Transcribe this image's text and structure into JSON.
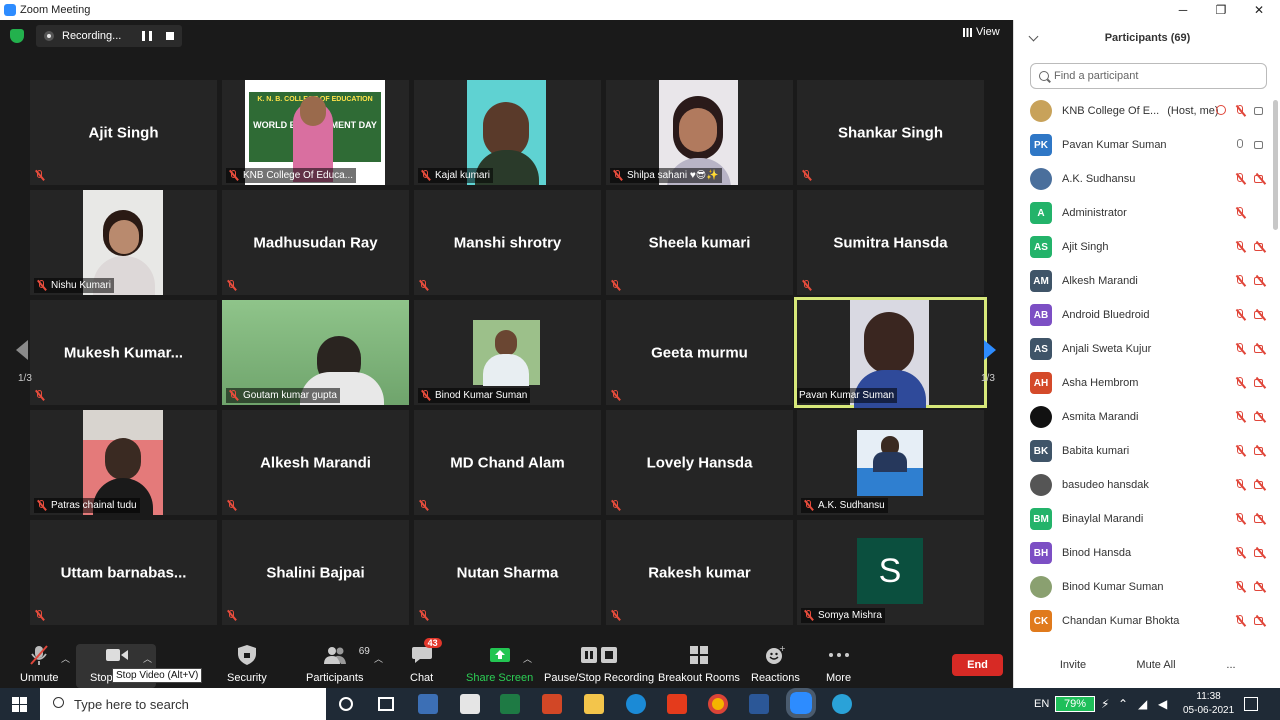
{
  "window": {
    "title": "Zoom Meeting",
    "min": "─",
    "max": "❐",
    "close": "✕"
  },
  "meeting": {
    "recording_label": "Recording...",
    "view_label": "View",
    "page_indicator_left": "1/3",
    "page_indicator_right": "1/3",
    "tiles": [
      {
        "name": "Ajit Singh",
        "label": ""
      },
      {
        "name": "",
        "label": "KNB College Of Educa..."
      },
      {
        "name": "",
        "label": "Kajal kumari"
      },
      {
        "name": "",
        "label": "Shilpa sahani ♥😎✨"
      },
      {
        "name": "Shankar Singh",
        "label": ""
      },
      {
        "name": "",
        "label": "Nishu Kumari"
      },
      {
        "name": "Madhusudan Ray",
        "label": ""
      },
      {
        "name": "Manshi shrotry",
        "label": ""
      },
      {
        "name": "Sheela kumari",
        "label": ""
      },
      {
        "name": "Sumitra Hansda",
        "label": ""
      },
      {
        "name": "Mukesh  Kumar...",
        "label": ""
      },
      {
        "name": "",
        "label": "Goutam kumar gupta"
      },
      {
        "name": "",
        "label": "Binod Kumar Suman"
      },
      {
        "name": "Geeta murmu",
        "label": ""
      },
      {
        "name": "",
        "label": "Pavan Kumar Suman"
      },
      {
        "name": "",
        "label": "Patras chainal tudu"
      },
      {
        "name": "Alkesh Marandi",
        "label": ""
      },
      {
        "name": "MD Chand Alam",
        "label": ""
      },
      {
        "name": "Lovely Hansda",
        "label": ""
      },
      {
        "name": "",
        "label": "A.K. Sudhansu"
      },
      {
        "name": "Uttam  barnabas...",
        "label": ""
      },
      {
        "name": "Shalini Bajpai",
        "label": ""
      },
      {
        "name": "Nutan Sharma",
        "label": ""
      },
      {
        "name": "Rakesh kumar",
        "label": ""
      },
      {
        "name": "",
        "label": "Somya Mishra",
        "avatar_letter": "S"
      }
    ],
    "slide_text": {
      "line1": "K. N. B. COLLEGE OF EDUCATION",
      "line2": "WORLD ENVIRONMENT DAY"
    }
  },
  "toolbar": {
    "unmute": "Unmute",
    "stop_video": "Stop",
    "tooltip": "Stop Video (Alt+V)",
    "security": "Security",
    "participants": "Participants",
    "participants_count": "69",
    "chat": "Chat",
    "chat_badge": "43",
    "share_screen": "Share Screen",
    "recording": "Pause/Stop Recording",
    "breakout": "Breakout Rooms",
    "reactions": "Reactions",
    "more": "More",
    "end": "End"
  },
  "participants_panel": {
    "title": "Participants (69)",
    "search_placeholder": "Find a participant",
    "invite": "Invite",
    "mute_all": "Mute All",
    "more": "...",
    "list": [
      {
        "initials": "",
        "name": "KNB College Of E...",
        "suffix": "(Host, me)",
        "color": "#c8a25a",
        "mic": "off",
        "video": "on",
        "recording": true
      },
      {
        "initials": "PK",
        "name": "Pavan Kumar Suman",
        "color": "#2f77c6",
        "mic": "on",
        "video": "on"
      },
      {
        "initials": "",
        "name": "A.K. Sudhansu",
        "color": "#4a6f9c",
        "mic": "off",
        "video": "off"
      },
      {
        "initials": "A",
        "name": "Administrator",
        "color": "#23b36a",
        "mic": "off",
        "video": ""
      },
      {
        "initials": "AS",
        "name": "Ajit Singh",
        "color": "#23b36a",
        "mic": "off",
        "video": "off"
      },
      {
        "initials": "AM",
        "name": "Alkesh Marandi",
        "color": "#3f5468",
        "mic": "off",
        "video": "off"
      },
      {
        "initials": "AB",
        "name": "Android Bluedroid",
        "color": "#7c4fc4",
        "mic": "off",
        "video": "off"
      },
      {
        "initials": "AS",
        "name": "Anjali Sweta Kujur",
        "color": "#3f5468",
        "mic": "off",
        "video": "off"
      },
      {
        "initials": "AH",
        "name": "Asha Hembrom",
        "color": "#d44a2a",
        "mic": "off",
        "video": "off"
      },
      {
        "initials": "",
        "name": "Asmita Marandi",
        "color": "#111111",
        "mic": "off",
        "video": "off"
      },
      {
        "initials": "BK",
        "name": "Babita kumari",
        "color": "#3f5468",
        "mic": "off",
        "video": "off"
      },
      {
        "initials": "",
        "name": "basudeo hansdak",
        "color": "#555555",
        "mic": "off",
        "video": "off"
      },
      {
        "initials": "BM",
        "name": "Binaylal Marandi",
        "color": "#23b36a",
        "mic": "off",
        "video": "off"
      },
      {
        "initials": "BH",
        "name": "Binod Hansda",
        "color": "#7c4fc4",
        "mic": "off",
        "video": "off"
      },
      {
        "initials": "",
        "name": "Binod Kumar Suman",
        "color": "#8aa070",
        "mic": "off",
        "video": "off"
      },
      {
        "initials": "CK",
        "name": "Chandan Kumar Bhokta",
        "color": "#e07a1c",
        "mic": "off",
        "video": "off"
      }
    ]
  },
  "taskbar": {
    "search_placeholder": "Type here to search",
    "lang": "EN",
    "battery": "79%",
    "time": "11:38",
    "date": "05-06-2021"
  }
}
